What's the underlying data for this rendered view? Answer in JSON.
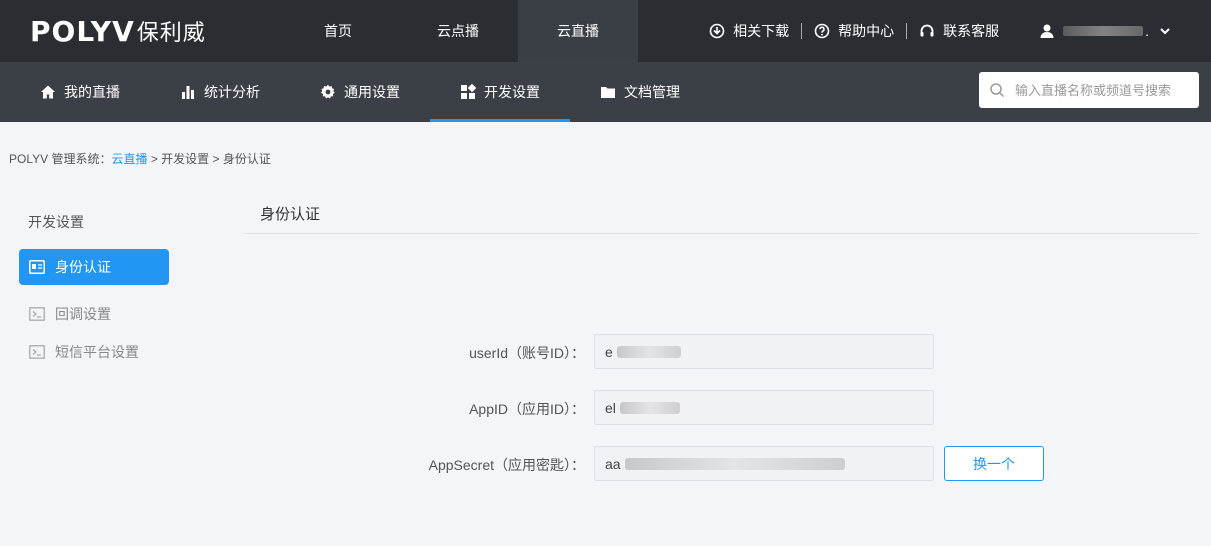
{
  "logo": {
    "brand": "POLYV",
    "cn": "保利威"
  },
  "topnav": [
    {
      "label": "首页"
    },
    {
      "label": "云点播"
    },
    {
      "label": "云直播"
    }
  ],
  "topright": {
    "download": "相关下载",
    "help": "帮助中心",
    "support": "联系客服",
    "user_suffix": "."
  },
  "subnav": [
    {
      "label": "我的直播",
      "icon": "home-icon"
    },
    {
      "label": "统计分析",
      "icon": "bar-chart-icon"
    },
    {
      "label": "通用设置",
      "icon": "gear-icon"
    },
    {
      "label": "开发设置",
      "icon": "grid-icon"
    },
    {
      "label": "文档管理",
      "icon": "folder-icon"
    }
  ],
  "search": {
    "placeholder": "输入直播名称或频道号搜索"
  },
  "breadcrumb": {
    "prefix": "POLYV 管理系统：",
    "level1": "云直播",
    "sep1": " > ",
    "level2": "开发设置",
    "sep2": " > ",
    "level3": "身份认证"
  },
  "sidebar": {
    "title": "开发设置",
    "items": [
      {
        "label": "身份认证"
      },
      {
        "label": "回调设置"
      },
      {
        "label": "短信平台设置"
      }
    ]
  },
  "main": {
    "title": "身份认证",
    "fields": [
      {
        "label": "userId（账号ID）：",
        "value_prefix": "e"
      },
      {
        "label": "AppID（应用ID）：",
        "value_prefix": "el"
      },
      {
        "label": "AppSecret（应用密匙）：",
        "value_prefix": "aa"
      }
    ],
    "change_button": "换一个"
  },
  "colors": {
    "accent": "#2196f3",
    "topbar": "#2a2e33",
    "subbar": "#3b4046"
  }
}
